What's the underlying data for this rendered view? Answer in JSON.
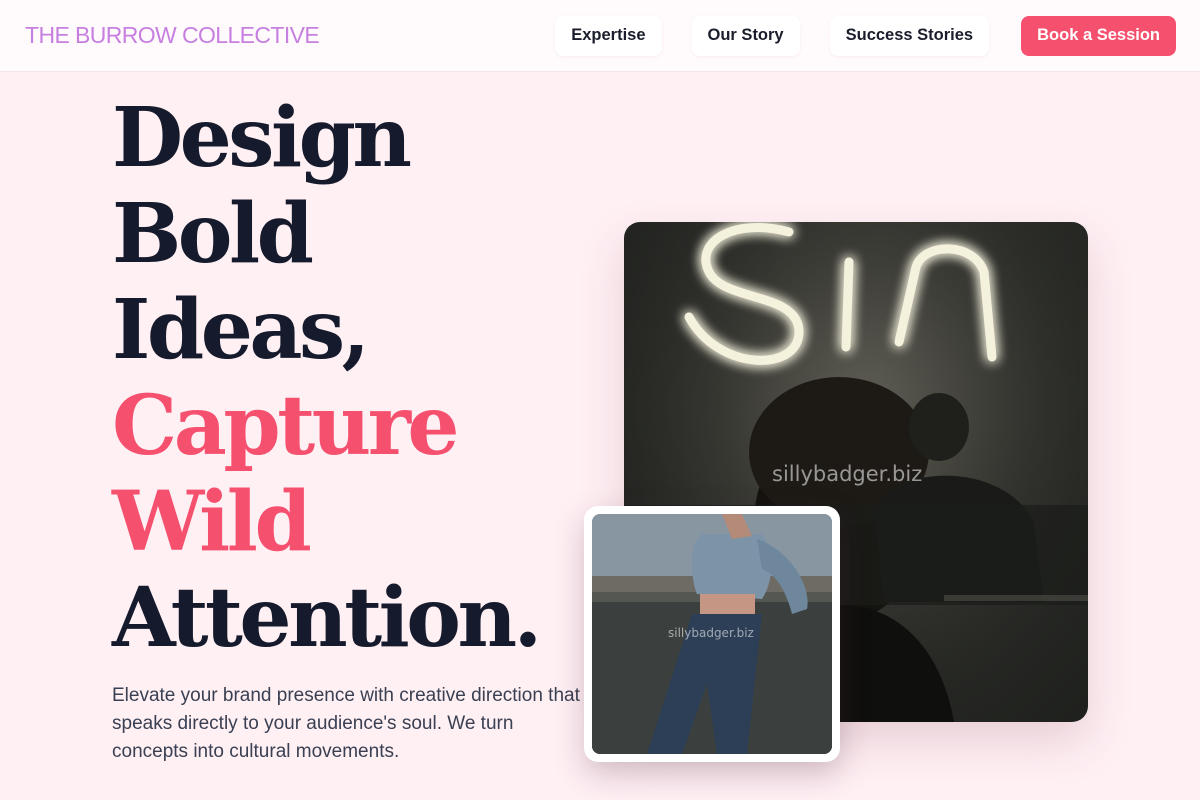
{
  "nav": {
    "brand": "THE BURROW COLLECTIVE",
    "links": [
      "Expertise",
      "Our Story",
      "Success Stories"
    ],
    "cta": "Book a Session"
  },
  "hero": {
    "title_lines": [
      "Design",
      "Bold",
      "Ideas,"
    ],
    "title_accent_lines": [
      "Capture",
      "Wild"
    ],
    "title_end_line": "Attention.",
    "subtitle": "Elevate your brand presence with creative direction that speaks directly to your audience's soul. We turn concepts into cultural movements."
  },
  "images": {
    "main_watermark": "sillybadger.biz",
    "small_watermark": "sillybadger.biz"
  },
  "colors": {
    "brand": "#c77fe0",
    "accent": "#f6506f",
    "heading": "#151a2c",
    "background": "#fff0f4"
  }
}
